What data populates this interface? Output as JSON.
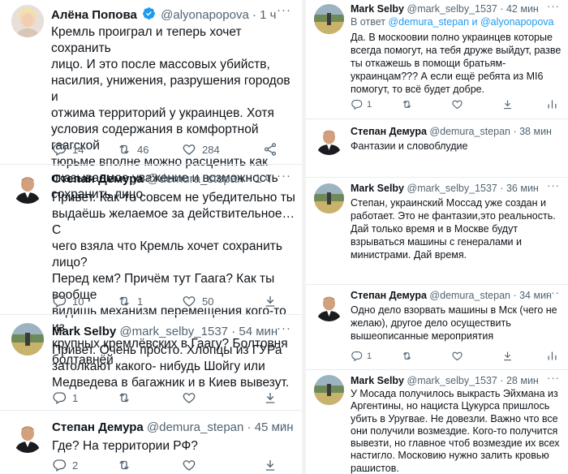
{
  "left": [
    {
      "avatar": "woman-avatar",
      "name": "Алёна Попова",
      "verified": true,
      "handle": "@alyonapopova",
      "time": "· 1 ч",
      "text": "Кремль проиграл и теперь хочет сохранить\nлицо. И это после массовых убийств,\nнасилия, унижения, разрушения городов и\nотжима территорий у украинцев. Хотя\nусловия содержания в комфортной гаагской\nтюрьме вполне можно расценить как\nоказываемое уважение и возможность\nсохранить лицо",
      "replies": "14",
      "retweets": "46",
      "likes": "284"
    },
    {
      "avatar": "man-avatar",
      "name": "Степан Демура",
      "handle": "@demura_stepan",
      "time": "· 1 ч",
      "text": "Привет. Как-то совсем не убедительно ты\nвыдаёшь желаемое за действительное… С\nчего взяла что Кремль хочет сохранить лицо?\nПеред кем? Причём тут Гаага? Как ты вообще\nвидишь механизм перемещения кого-то из\nкрупных кремлёвских в Гаагу? Болтовня\nболтавнёй",
      "replies": "10",
      "retweets": "1",
      "likes": "50"
    },
    {
      "avatar": "field-avatar",
      "name": "Mark Selby",
      "handle": "@mark_selby_1537",
      "time": "· 54 мин",
      "text": "Привет. Очень просто. Хлопцы из ГУРа\nзатолкают какого- нибудь Шойгу или\nМедведева в багажник и в Киев вывезут.",
      "replies": "1",
      "retweets": "",
      "likes": ""
    },
    {
      "avatar": "man-avatar",
      "name": "Степан Демура",
      "handle": "@demura_stepan",
      "time": "· 45 мин",
      "text": "Где? На территории РФ?",
      "replies": "2",
      "retweets": "",
      "likes": ""
    }
  ],
  "right": [
    {
      "avatar": "field-avatar",
      "name": "Mark Selby",
      "handle": "@mark_selby_1537",
      "time": "· 42 мин",
      "reply_prefix": "В ответ",
      "reply_to": "@demura_stepan и @alyonapopova",
      "text": "Да. В москоовии полно украинцев которые\nвсегда помогут, на тебя дружe выйдут, разве\nты откажешь в помощи братьям-\nукраинцам??? А если ещё ребята из МI6\nпомогут, то всё будет добре.",
      "replies": "1",
      "retweets": "",
      "likes": ""
    },
    {
      "avatar": "man-avatar",
      "name": "Степан Демура",
      "handle": "@demura_stepan",
      "time": "· 38 мин",
      "text": "Фантазии и словоблудие"
    },
    {
      "avatar": "field-avatar",
      "name": "Mark Selby",
      "handle": "@mark_selby_1537",
      "time": "· 36 мин",
      "text": "Степан, украинский Моссад уже создан и\nработает. Это не фантазии,это реальность.\nДай только время и в Москве будут\nвзрываться машины с генералами и\nминистрами. Дай время."
    },
    {
      "avatar": "man-avatar",
      "name": "Степан Демура",
      "handle": "@demura_stepan",
      "time": "· 34 мин",
      "text": "Одно дело взорвать машины в Мск (чего не\nжелаю), другое дело осуществить\nвышеописанные мероприятия",
      "replies": "1",
      "retweets": "",
      "likes": ""
    },
    {
      "avatar": "field-avatar",
      "name": "Mark Selby",
      "handle": "@mark_selby_1537",
      "time": "· 28 мин",
      "text": "У Мосада получилось выкрасть Эйхмана из\nАргентины, но нациста Цукурса пришлось\nубить в Уругвае. Не довезли. Важно что все\nони получили возмездие. Кого-то получится\nвывезти, но главное чтоб возмездие их всех\nнастигло. Московию нужно залить кровью\nрашистов."
    }
  ],
  "colors": {
    "text": "#0f1419",
    "muted": "#536471",
    "verified": "#1d9bf0",
    "link": "#1d9bf0",
    "separator": "#e6ecf0"
  }
}
